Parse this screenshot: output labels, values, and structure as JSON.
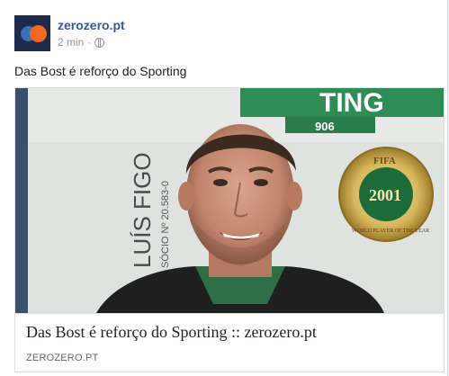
{
  "post": {
    "page_name": "zerozero.pt",
    "timestamp": "2 min",
    "separator": "·",
    "privacy_icon": "globe-icon",
    "text": "Das Bost é reforço do Sporting"
  },
  "link_card": {
    "title": "Das Bost é reforço do Sporting :: zerozero.pt",
    "domain": "ZEROZERO.PT",
    "image": {
      "banner_text": "TING",
      "banner_number": "906",
      "shirt_name": "LUÍS FIGO",
      "shirt_subtext": "SÓCIO Nº 20.583-0",
      "badge_top": "FIFA",
      "badge_year": "2001",
      "badge_bottom": "WORLD PLAYER OF THE YEAR"
    }
  },
  "colors": {
    "link_blue": "#365899",
    "meta_gray": "#90949c",
    "avatar_bg": "#1c2a4b",
    "logo_orange": "#f26a21",
    "logo_blue": "#3b6fb5"
  }
}
